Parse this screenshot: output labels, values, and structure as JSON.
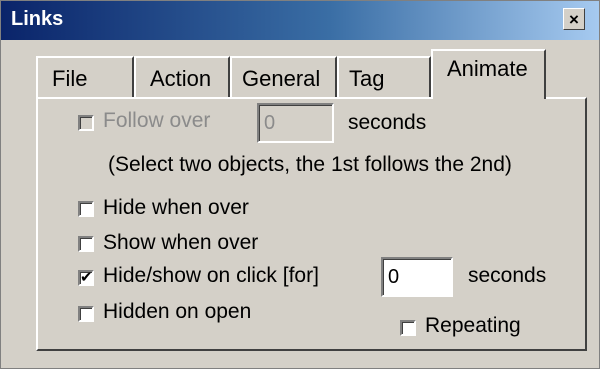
{
  "window": {
    "title": "Links",
    "close_glyph": "×"
  },
  "tabs": [
    "File",
    "Action",
    "General",
    "Tag",
    "Animate"
  ],
  "active_tab": "Animate",
  "follow_over": {
    "label": "Follow over",
    "value": "0",
    "unit": "seconds",
    "enabled": false,
    "checked": false
  },
  "hint": "(Select two objects, the 1st follows the 2nd)",
  "options": {
    "hide_when_over": {
      "label": "Hide when over",
      "checked": false
    },
    "show_when_over": {
      "label": "Show when over",
      "checked": false
    },
    "hide_show_on_click": {
      "label": "Hide/show on click [for]",
      "checked": true,
      "value": "0",
      "unit": "seconds"
    },
    "hidden_on_open": {
      "label": "Hidden on open",
      "checked": false
    },
    "repeating": {
      "label": "Repeating",
      "checked": false
    }
  },
  "icons": {
    "checkmark": "✔",
    "close": "close-icon"
  }
}
